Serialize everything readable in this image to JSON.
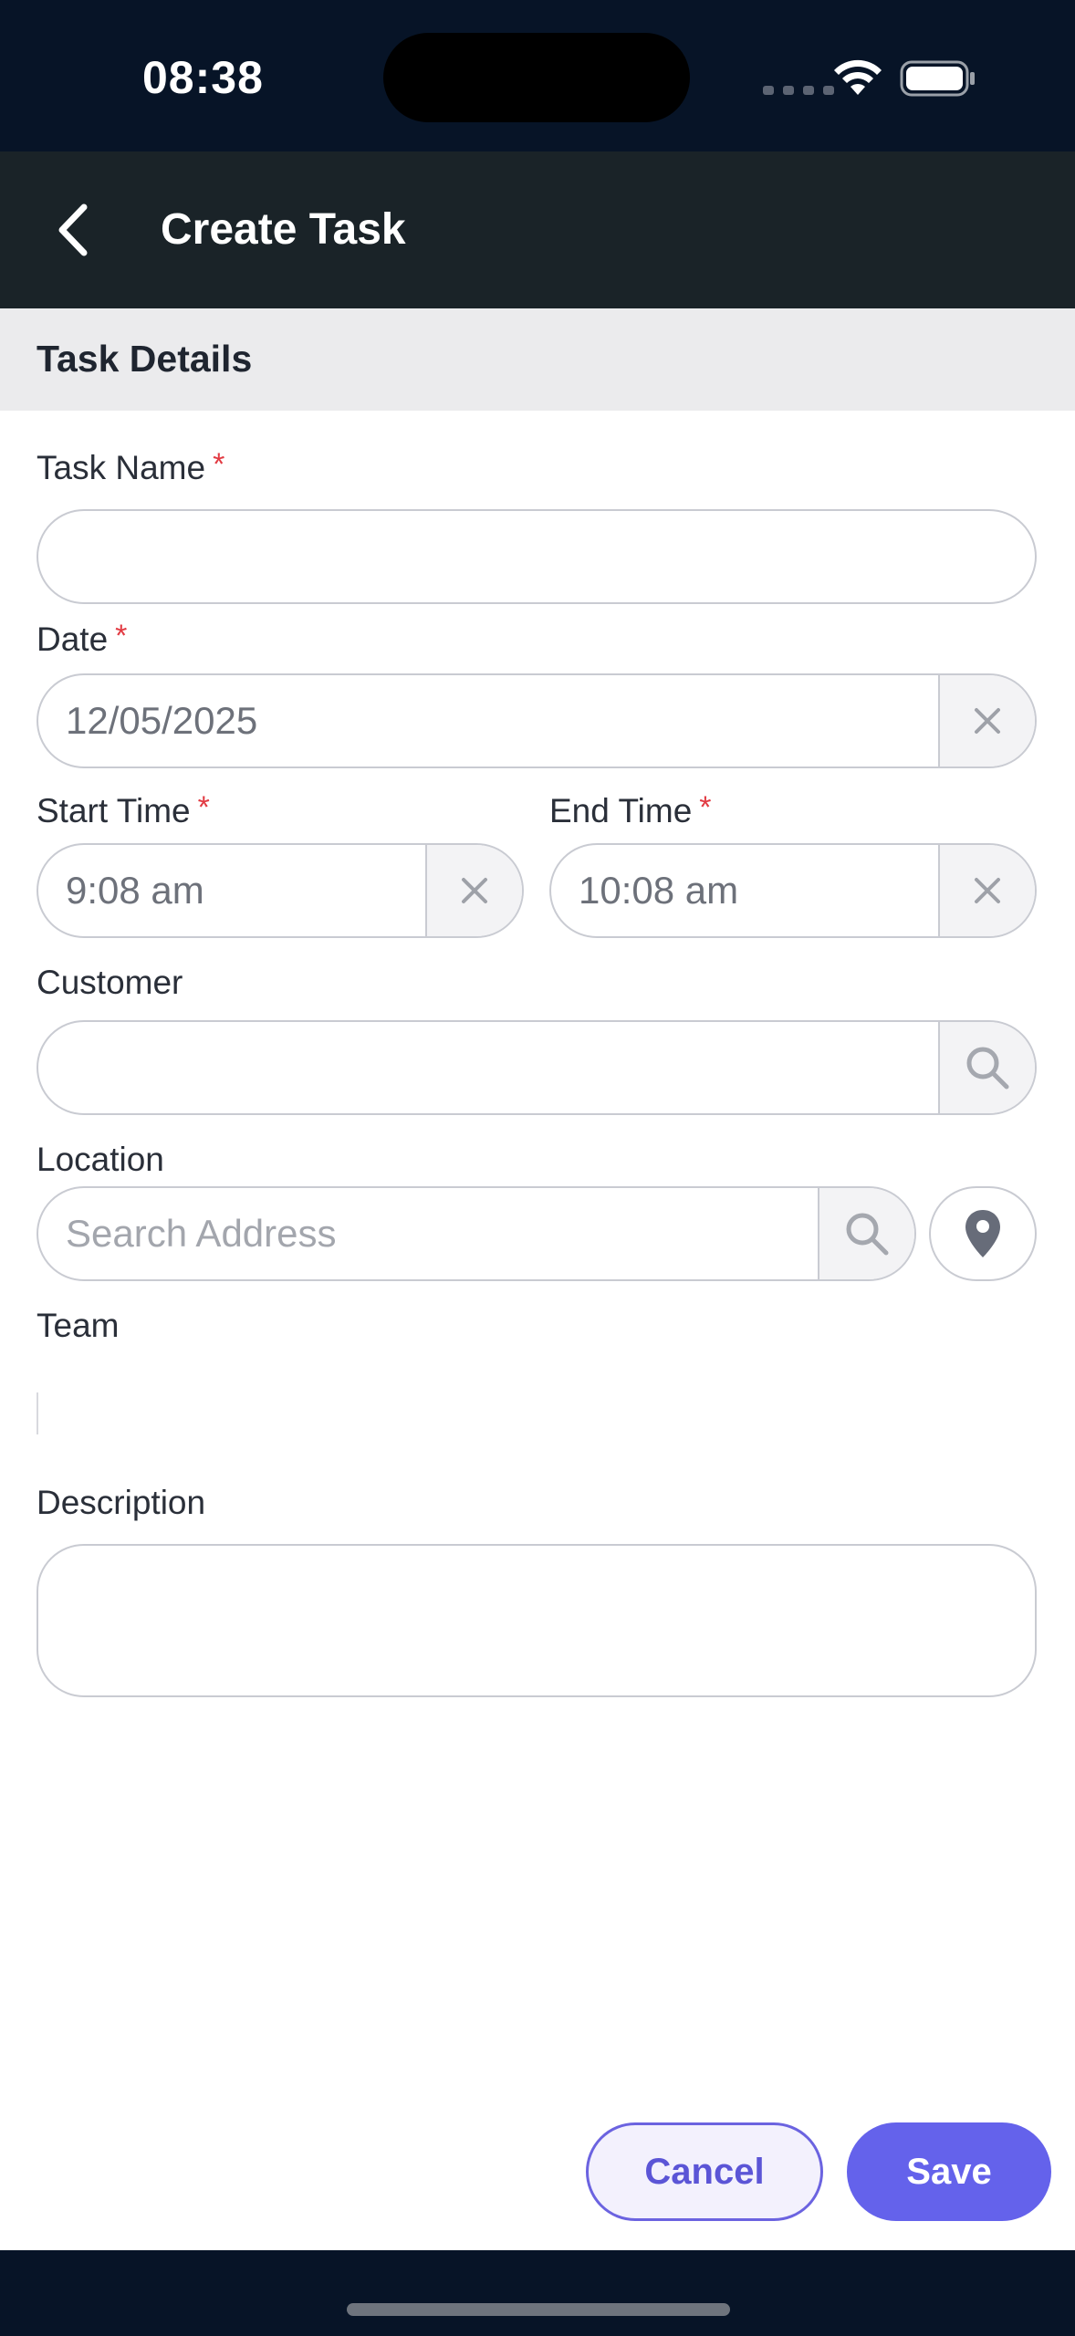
{
  "status_bar": {
    "time": "08:38"
  },
  "header": {
    "title": "Create Task",
    "back_icon": "chevron-left-icon"
  },
  "section": {
    "title": "Task Details"
  },
  "form": {
    "task_name": {
      "label": "Task Name",
      "required_mark": "*",
      "value": ""
    },
    "date": {
      "label": "Date",
      "required_mark": "*",
      "value": "12/05/2025",
      "clear_icon": "close-icon"
    },
    "start_time": {
      "label": "Start Time",
      "required_mark": "*",
      "value": "9:08 am",
      "clear_icon": "close-icon"
    },
    "end_time": {
      "label": "End Time",
      "required_mark": "*",
      "value": "10:08 am",
      "clear_icon": "close-icon"
    },
    "customer": {
      "label": "Customer",
      "value": "",
      "search_icon": "search-icon"
    },
    "location": {
      "label": "Location",
      "placeholder": "Search Address",
      "value": "",
      "search_icon": "search-icon",
      "pin_icon": "map-pin-icon"
    },
    "team": {
      "label": "Team"
    },
    "description": {
      "label": "Description",
      "value": ""
    }
  },
  "actions": {
    "cancel_label": "Cancel",
    "save_label": "Save"
  },
  "colors": {
    "status_bar_bg": "#071427",
    "header_bg": "#1a2328",
    "section_bg": "#ebebed",
    "required": "#e23b43",
    "primary": "#6462eb"
  }
}
